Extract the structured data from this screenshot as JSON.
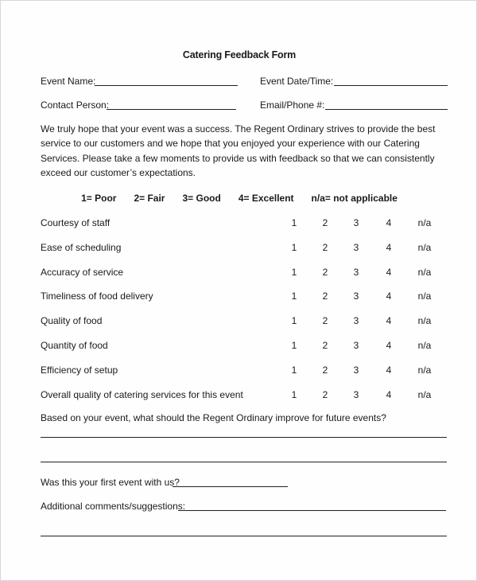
{
  "document": {
    "title": "Catering Feedback Form",
    "fields": {
      "event_name": "Event Name:",
      "event_datetime": "Event Date/Time:",
      "contact_person": "Contact Person:",
      "email_phone": "Email/Phone #:"
    },
    "intro": "We truly hope that your event was a success.  The Regent Ordinary strives to provide the best service to our customers and we hope that you enjoyed your experience with our Catering Services.  Please take a few moments to provide us with feedback so that we can consistently exceed our customer’s expectations.",
    "scale": [
      "1= Poor",
      "2= Fair",
      "3= Good",
      "4= Excellent",
      "n/a= not applicable"
    ],
    "options": [
      "1",
      "2",
      "3",
      "4",
      "n/a"
    ],
    "questions": [
      "Courtesy of staff",
      "Ease of scheduling",
      "Accuracy of service",
      "Timeliness of food delivery",
      "Quality of food",
      "Quantity of food",
      "Efficiency of setup",
      "Overall quality of catering services for this event"
    ],
    "improve_question": "Based on your event, what should the Regent Ordinary improve for future events?",
    "first_event_question": "Was this your first event with us?",
    "comments_label": "Additional comments/suggestions:"
  }
}
